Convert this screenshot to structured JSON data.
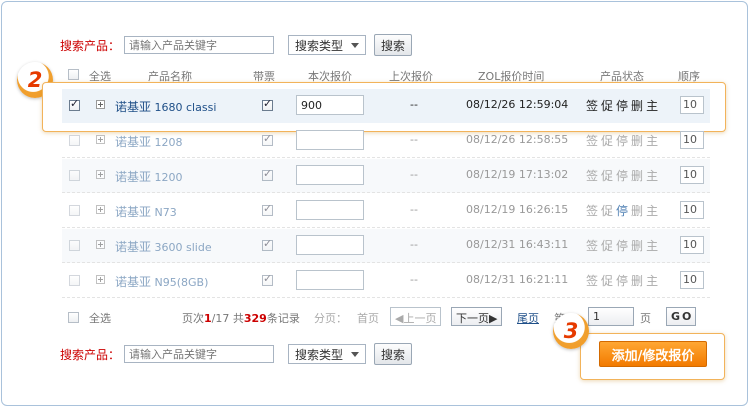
{
  "search": {
    "label": "搜索产品：",
    "placeholder": "请输入产品关键字",
    "type_select": "搜索类型",
    "button": "搜索"
  },
  "table": {
    "headers": {
      "select_all": "全选",
      "name": "产品名称",
      "invoice": "带票",
      "current_price": "本次报价",
      "last_price": "上次报价",
      "zol_time": "ZOL报价时间",
      "status": "产品状态",
      "order": "顺序"
    },
    "rows": [
      {
        "brand": "诺基亚",
        "model": "1680 classi",
        "price": "900",
        "last": "--",
        "time": "08/12/26 12:59:04",
        "status": [
          "签",
          "促",
          "停",
          "删",
          "主"
        ],
        "order": "10",
        "checked": true,
        "invoice_checked": true
      },
      {
        "brand": "诺基亚",
        "model": "1208",
        "price": "",
        "last": "--",
        "time": "08/12/26 12:58:55",
        "status": [
          "签",
          "促",
          "停",
          "删",
          "主"
        ],
        "order": "10",
        "checked": false,
        "invoice_checked": true
      },
      {
        "brand": "诺基亚",
        "model": "1200",
        "price": "",
        "last": "--",
        "time": "08/12/19 17:13:02",
        "status": [
          "签",
          "促",
          "停",
          "删",
          "主"
        ],
        "order": "10",
        "checked": false,
        "invoice_checked": true
      },
      {
        "brand": "诺基亚",
        "model": "N73",
        "price": "",
        "last": "--",
        "time": "08/12/19 16:26:15",
        "status": [
          "签",
          "促",
          "停",
          "删",
          "主"
        ],
        "order": "10",
        "checked": false,
        "invoice_checked": true
      },
      {
        "brand": "诺基亚",
        "model": "3600 slide",
        "price": "",
        "last": "--",
        "time": "08/12/31 16:43:11",
        "status": [
          "签",
          "促",
          "停",
          "删",
          "主"
        ],
        "order": "10",
        "checked": false,
        "invoice_checked": true
      },
      {
        "brand": "诺基亚",
        "model": "N95(8GB)",
        "price": "",
        "last": "--",
        "time": "08/12/31 16:21:11",
        "status": [
          "签",
          "促",
          "停",
          "删",
          "主"
        ],
        "order": "10",
        "checked": false,
        "invoice_checked": true
      }
    ]
  },
  "pager": {
    "select_all": "全选",
    "page_prefix": "页次",
    "current_page": "1",
    "total_pages": "/17",
    "total_prefix": "共",
    "total_count": "329",
    "total_suffix": "条记录",
    "paging_label": "分页：",
    "first": "首页",
    "prev": "◀上一页",
    "next": "下一页▶",
    "last": "尾页",
    "goto_prefix": "第",
    "goto_value": "1",
    "goto_suffix": "页",
    "go": "GO"
  },
  "callouts": {
    "step2": "2",
    "step3": "3"
  },
  "submit": {
    "label": "添加/修改报价"
  },
  "colors": {
    "accent": "#f27a00",
    "alert": "#cc0000",
    "link": "#1f4f88"
  }
}
